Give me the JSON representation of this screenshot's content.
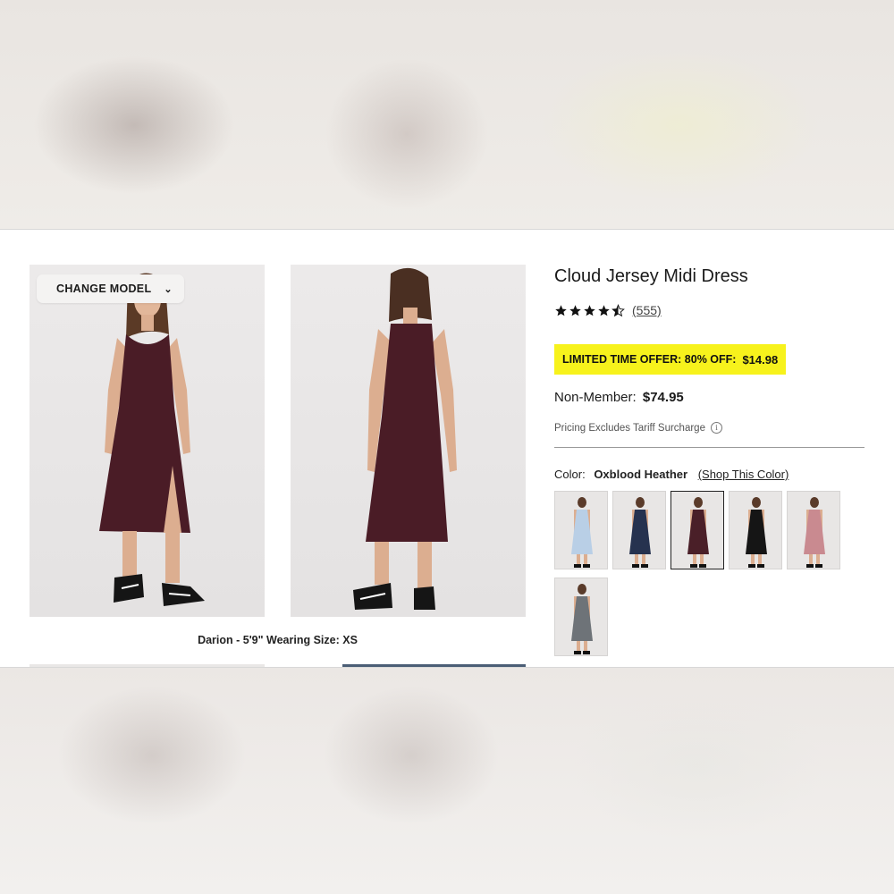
{
  "gallery": {
    "change_model_label": "CHANGE MODEL",
    "model_caption": "Darion - 5'9\" Wearing Size: XS"
  },
  "product": {
    "title": "Cloud Jersey Midi Dress",
    "rating": 4.5,
    "review_count": "(555)",
    "offer": {
      "label": "LIMITED TIME OFFER: 80% OFF:",
      "price": "$14.98",
      "highlight_color": "#f7f21c"
    },
    "non_member": {
      "label": "Non-Member:",
      "price": "$74.95"
    },
    "tariff_note": "Pricing Excludes Tariff Surcharge",
    "color": {
      "label": "Color:",
      "selected_name": "Oxblood Heather",
      "shop_link": "(Shop This Color)"
    },
    "swatches": [
      {
        "name": "light-blue",
        "color": "#b9cfe6"
      },
      {
        "name": "navy",
        "color": "#26324f"
      },
      {
        "name": "oxblood-heather",
        "color": "#4a1f28",
        "selected": true
      },
      {
        "name": "black",
        "color": "#151515"
      },
      {
        "name": "rose",
        "color": "#c98a90"
      },
      {
        "name": "heather-grey",
        "color": "#6e7378"
      }
    ]
  },
  "colors": {
    "dress": "#4a1c26",
    "text": "#1a1a1a"
  },
  "icons": {
    "chevron": "chevron-down-icon",
    "star": "star-icon",
    "info": "info-icon"
  }
}
